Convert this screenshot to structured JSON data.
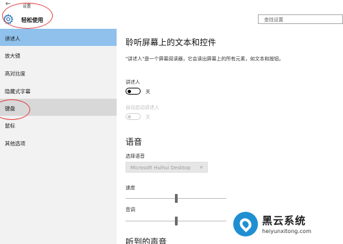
{
  "window": {
    "back_glyph": "←",
    "title": "设置"
  },
  "header": {
    "gear_icon": "gear-icon",
    "title": "轻松使用",
    "search_placeholder": "查找设置"
  },
  "sidebar": {
    "items": [
      {
        "label": "讲述人",
        "state": "active"
      },
      {
        "label": "放大镜",
        "state": "normal"
      },
      {
        "label": "高对比度",
        "state": "normal"
      },
      {
        "label": "隐藏式字幕",
        "state": "normal"
      },
      {
        "label": "键盘",
        "state": "hover"
      },
      {
        "label": "鼠标",
        "state": "normal"
      },
      {
        "label": "其他选项",
        "state": "normal"
      }
    ]
  },
  "main": {
    "section1_title": "聆听屏幕上的文本和控件",
    "description": "\"讲述人\"是一个屏幕阅读器，它会读出屏幕上的所有元素，如文本和按钮。",
    "narrator": {
      "label": "讲述人",
      "state": "关"
    },
    "autostart": {
      "label": "自动启动讲述人",
      "state": "关"
    },
    "section2_title": "语音",
    "voice": {
      "label": "选择语音",
      "value": "Microsoft Huihui Desktop",
      "chevron": "∨"
    },
    "speed": {
      "label": "速度",
      "level": 0.5
    },
    "pitch": {
      "label": "音调",
      "level": 0.5
    },
    "section3_title": "听到的声音"
  },
  "watermark": {
    "name": "黑云系统",
    "url": "heiyunxitong.com"
  },
  "colors": {
    "active": "#8fc1ec",
    "hover": "#d8d8d8",
    "sidebar_bg": "#f2f2f2",
    "annotation": "#e23b3b",
    "brand": "#1f8fd2"
  }
}
